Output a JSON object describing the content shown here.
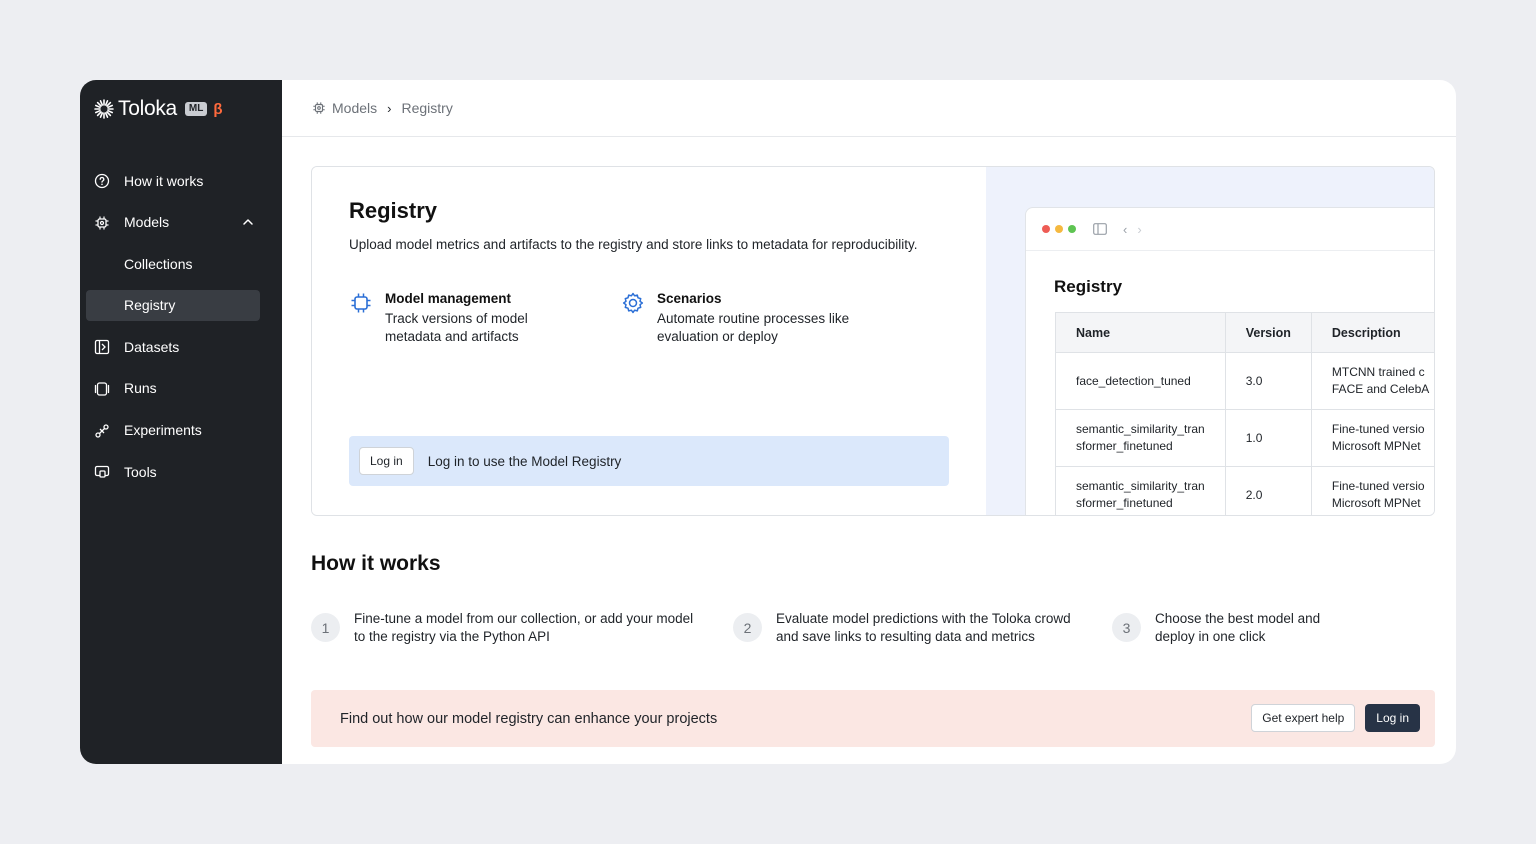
{
  "brand": {
    "name": "Toloka",
    "badge": "ML",
    "beta": "β"
  },
  "sidebar": {
    "items": [
      {
        "label": "How it works",
        "icon": "question-circle-icon"
      },
      {
        "label": "Models",
        "icon": "chip-icon",
        "expanded": true
      },
      {
        "label": "Collections"
      },
      {
        "label": "Registry",
        "active": true
      },
      {
        "label": "Datasets",
        "icon": "dataset-icon"
      },
      {
        "label": "Runs",
        "icon": "runs-icon"
      },
      {
        "label": "Experiments",
        "icon": "experiments-icon"
      },
      {
        "label": "Tools",
        "icon": "tools-icon"
      }
    ]
  },
  "breadcrumb": {
    "root": "Models",
    "current": "Registry"
  },
  "hero": {
    "title": "Registry",
    "subtitle": "Upload model metrics and artifacts to the registry and store links to metadata for reproducibility.",
    "features": [
      {
        "title": "Model management",
        "desc_line1": "Track versions of model",
        "desc_line2": "metadata and artifacts"
      },
      {
        "title": "Scenarios",
        "desc_line1": "Automate routine processes like",
        "desc_line2": "evaluation or deploy"
      }
    ],
    "login_button": "Log in",
    "login_message": "Log in to use the Model Registry"
  },
  "preview": {
    "title": "Registry",
    "headers": [
      "Name",
      "Version",
      "Description"
    ],
    "rows": [
      {
        "name_l1": "face_detection_tuned",
        "name_l2": "",
        "version": "3.0",
        "desc_l1": "MTCNN trained c",
        "desc_l2": "FACE and CelebA"
      },
      {
        "name_l1": "semantic_similarity_tran",
        "name_l2": "sformer_finetuned",
        "version": "1.0",
        "desc_l1": "Fine-tuned versio",
        "desc_l2": "Microsoft MPNet"
      },
      {
        "name_l1": "semantic_similarity_tran",
        "name_l2": "sformer_finetuned",
        "version": "2.0",
        "desc_l1": "Fine-tuned versio",
        "desc_l2": "Microsoft MPNet"
      }
    ],
    "dot_colors": [
      "#ee5c55",
      "#f5b940",
      "#5ec452"
    ]
  },
  "how": {
    "title": "How it works",
    "steps": [
      {
        "num": "1",
        "l1": "Fine-tune a model from our collection, or add your model",
        "l2": "to the registry via the Python API"
      },
      {
        "num": "2",
        "l1": "Evaluate model predictions with the Toloka crowd",
        "l2": "and save links to resulting data and metrics"
      },
      {
        "num": "3",
        "l1": "Choose the best model and",
        "l2": "deploy in one click"
      }
    ]
  },
  "cta": {
    "text": "Find out how our model registry can enhance your projects",
    "expert": "Get expert help",
    "login": "Log in"
  },
  "colors": {
    "sidebar_bg": "#1f2226",
    "accent_blue": "#2b6fd6",
    "beta": "#ff6a3d",
    "cta_bg": "#fbe7e3",
    "banner_bg": "#dbe8fb"
  }
}
